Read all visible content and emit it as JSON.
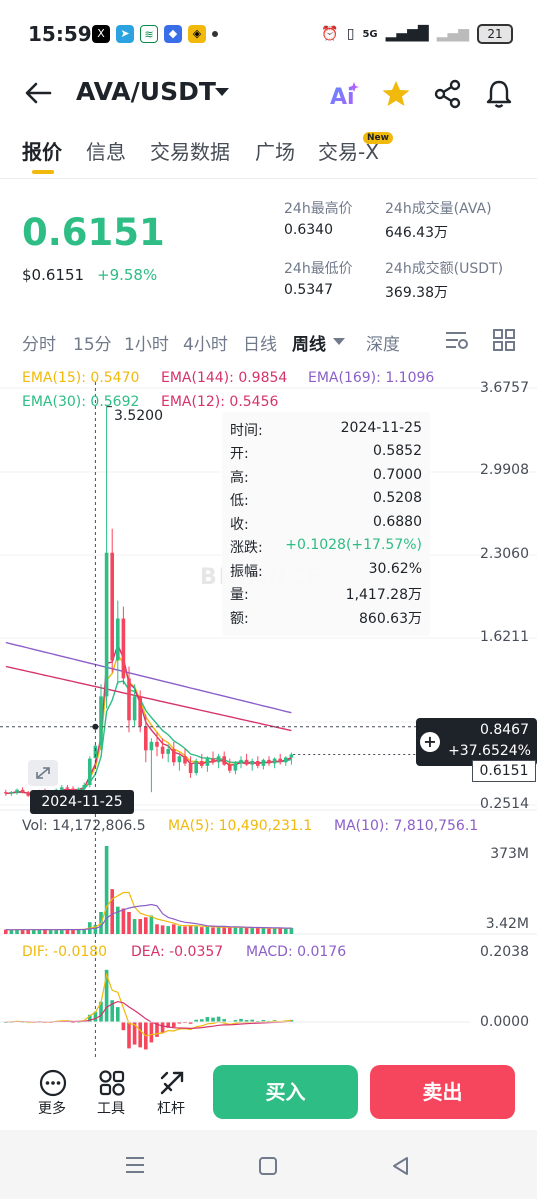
{
  "status_bar": {
    "time": "15:59",
    "network": "5G",
    "battery": "21"
  },
  "header": {
    "pair": "AVA/USDT",
    "icons": [
      "back-arrow-icon",
      "pair-dropdown-icon",
      "ai-icon",
      "star-icon",
      "share-icon",
      "bell-icon"
    ],
    "star_color": "#f0b90b"
  },
  "tabs": {
    "items": [
      "报价",
      "信息",
      "交易数据",
      "广场",
      "交易-X"
    ],
    "active_index": 0,
    "new_badge": "New"
  },
  "price": {
    "last": "0.6151",
    "usd": "$0.6151",
    "change": "+9.58%",
    "up_color": "#2ebd85",
    "down_color": "#f6465d",
    "stats": {
      "high_label": "24h最高价",
      "high": "0.6340",
      "low_label": "24h最低价",
      "low": "0.5347",
      "vol_ava_label": "24h成交量(AVA)",
      "vol_ava": "646.43万",
      "vol_usdt_label": "24h成交额(USDT)",
      "vol_usdt": "369.38万"
    }
  },
  "intervals": {
    "items": [
      "分时",
      "15分",
      "1小时",
      "4小时",
      "日线",
      "周线",
      "深度"
    ],
    "active": "周线"
  },
  "chart": {
    "ema": {
      "ema15": "EMA(15): 0.5470",
      "ema144": "EMA(144): 0.9854",
      "ema169": "EMA(169): 1.1096",
      "ema30": "EMA(30): 0.5692",
      "ema12": "EMA(12): 0.5456"
    },
    "price_axis": [
      "3.6757",
      "2.9908",
      "2.3060",
      "1.6211",
      "0.2514"
    ],
    "peak_label": "3.5200",
    "watermark": "BINANCE",
    "tooltip": {
      "rows": [
        {
          "k": "时间:",
          "v": "2024-11-25"
        },
        {
          "k": "开:",
          "v": "0.5852"
        },
        {
          "k": "高:",
          "v": "0.7000"
        },
        {
          "k": "低:",
          "v": "0.5208"
        },
        {
          "k": "收:",
          "v": "0.6880"
        },
        {
          "k": "涨跌:",
          "v": "+0.1028(+17.57%)"
        },
        {
          "k": "振幅:",
          "v": "30.62%"
        },
        {
          "k": "量:",
          "v": "1,417.28万"
        },
        {
          "k": "额:",
          "v": "860.63万"
        }
      ]
    },
    "cross_date": "2024-11-25",
    "cross_price": "0.8467",
    "cross_pct": "+37.6524%",
    "current_price": "0.6151",
    "volume": {
      "vol": "Vol: 14,172,806.5",
      "ma5": "MA(5): 10,490,231.1",
      "ma10": "MA(10): 7,810,756.1",
      "axis_top": "373M",
      "axis_bottom": "3.42M"
    },
    "macd": {
      "dif": "DIF: -0.0180",
      "dea": "DEA: -0.0357",
      "macd": "MACD: 0.0176",
      "axis_top": "0.2038",
      "axis_zero": "0.0000"
    },
    "candles": [
      [
        0.3,
        0.32,
        0.27,
        0.29
      ],
      [
        0.29,
        0.31,
        0.27,
        0.3
      ],
      [
        0.3,
        0.33,
        0.28,
        0.32
      ],
      [
        0.32,
        0.34,
        0.29,
        0.3
      ],
      [
        0.3,
        0.31,
        0.26,
        0.27
      ],
      [
        0.27,
        0.3,
        0.25,
        0.29
      ],
      [
        0.29,
        0.32,
        0.28,
        0.31
      ],
      [
        0.31,
        0.33,
        0.27,
        0.28
      ],
      [
        0.28,
        0.3,
        0.26,
        0.29
      ],
      [
        0.29,
        0.33,
        0.28,
        0.32
      ],
      [
        0.32,
        0.36,
        0.3,
        0.34
      ],
      [
        0.34,
        0.36,
        0.31,
        0.33
      ],
      [
        0.33,
        0.35,
        0.3,
        0.31
      ],
      [
        0.31,
        0.34,
        0.29,
        0.33
      ],
      [
        0.33,
        0.38,
        0.31,
        0.36
      ],
      [
        0.36,
        0.6,
        0.34,
        0.58
      ],
      [
        0.585,
        0.7,
        0.52,
        0.688
      ],
      [
        0.69,
        1.2,
        0.65,
        1.1
      ],
      [
        1.1,
        3.52,
        1.0,
        2.3
      ],
      [
        2.3,
        2.5,
        1.3,
        1.4
      ],
      [
        1.4,
        1.9,
        1.2,
        1.75
      ],
      [
        1.75,
        1.85,
        1.2,
        1.25
      ],
      [
        1.25,
        1.35,
        0.8,
        0.9
      ],
      [
        0.9,
        1.2,
        0.85,
        1.1
      ],
      [
        1.1,
        1.15,
        0.8,
        0.85
      ],
      [
        0.85,
        0.95,
        0.55,
        0.65
      ],
      [
        0.65,
        0.75,
        0.3,
        0.72
      ],
      [
        0.72,
        0.8,
        0.6,
        0.68
      ],
      [
        0.68,
        0.75,
        0.58,
        0.62
      ],
      [
        0.62,
        0.7,
        0.55,
        0.66
      ],
      [
        0.66,
        0.72,
        0.52,
        0.55
      ],
      [
        0.55,
        0.63,
        0.48,
        0.6
      ],
      [
        0.6,
        0.66,
        0.52,
        0.54
      ],
      [
        0.54,
        0.6,
        0.42,
        0.46
      ],
      [
        0.46,
        0.58,
        0.44,
        0.56
      ],
      [
        0.56,
        0.62,
        0.5,
        0.52
      ],
      [
        0.52,
        0.6,
        0.47,
        0.58
      ],
      [
        0.58,
        0.64,
        0.53,
        0.55
      ],
      [
        0.55,
        0.62,
        0.5,
        0.6
      ],
      [
        0.6,
        0.64,
        0.52,
        0.53
      ],
      [
        0.53,
        0.58,
        0.46,
        0.48
      ],
      [
        0.48,
        0.56,
        0.45,
        0.54
      ],
      [
        0.54,
        0.6,
        0.5,
        0.57
      ],
      [
        0.57,
        0.62,
        0.52,
        0.53
      ],
      [
        0.53,
        0.58,
        0.48,
        0.56
      ],
      [
        0.56,
        0.6,
        0.5,
        0.52
      ],
      [
        0.52,
        0.58,
        0.49,
        0.57
      ],
      [
        0.57,
        0.6,
        0.52,
        0.54
      ],
      [
        0.54,
        0.59,
        0.5,
        0.58
      ],
      [
        0.58,
        0.62,
        0.53,
        0.55
      ],
      [
        0.55,
        0.6,
        0.52,
        0.59
      ],
      [
        0.59,
        0.63,
        0.53,
        0.6151
      ]
    ]
  },
  "bottom_bar": {
    "more": "更多",
    "tools": "工具",
    "leverage": "杠杆",
    "buy": "买入",
    "sell": "卖出"
  },
  "nav_icons": [
    "menu-icon",
    "home-icon",
    "back-triangle-icon"
  ]
}
